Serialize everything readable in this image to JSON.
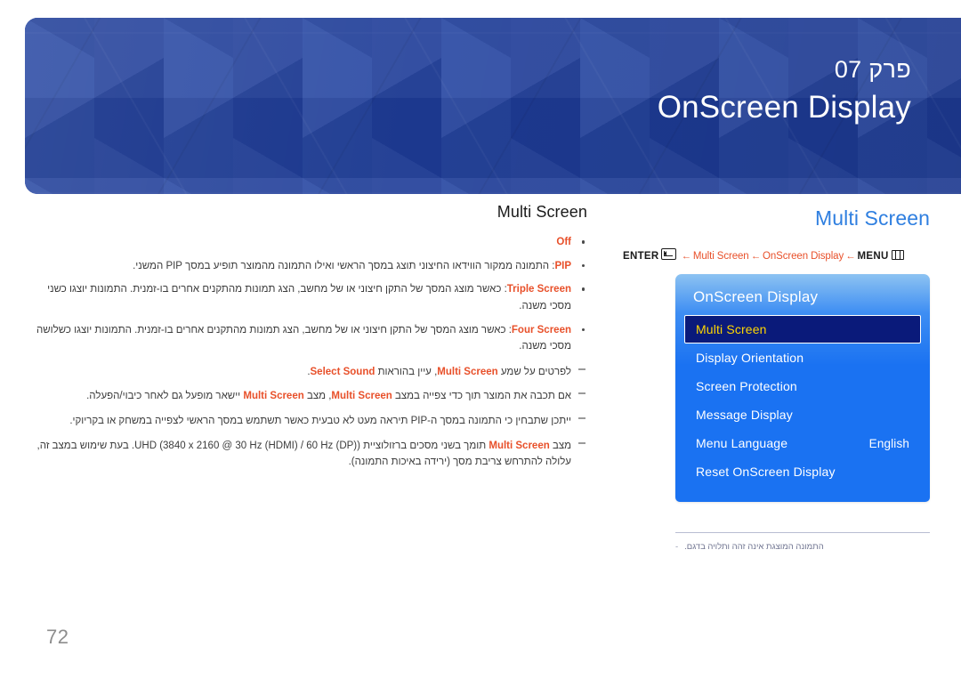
{
  "page": {
    "number": "72",
    "language_dir": "rtl"
  },
  "banner": {
    "chapter_label": "פרק 07",
    "chapter_title": "OnScreen Display",
    "bg_color": "#1f3f9e",
    "text_color": "#ffffff"
  },
  "right_column": {
    "section_title": "Multi Screen",
    "section_title_color": "#2f7fe0",
    "nav_path": {
      "enter_label": "ENTER",
      "enter_icon": "enter-icon",
      "arrow": "←",
      "crumb_1": "Multi Screen",
      "crumb_2": "OnScreen Display",
      "menu_label": "MENU",
      "menu_icon": "menu-icon",
      "crumb_color": "#e8502a"
    },
    "osd_panel": {
      "title": "OnScreen Display",
      "selected_index": 0,
      "selected_bg": "#0a1a7a",
      "selected_text_color": "#ffd700",
      "panel_color": "#1a72f2",
      "items": [
        {
          "label": "Multi Screen",
          "value": ""
        },
        {
          "label": "Display Orientation",
          "value": ""
        },
        {
          "label": "Screen Protection",
          "value": ""
        },
        {
          "label": "Message Display",
          "value": ""
        },
        {
          "label": "Menu Language",
          "value": "English"
        },
        {
          "label": "Reset OnScreen Display",
          "value": ""
        }
      ]
    },
    "footnote": {
      "dash": "-",
      "text": "התמונה המוצגת אינה זהה ותלויה בדגם."
    }
  },
  "left_column": {
    "section_title": "Multi Screen",
    "bullets": [
      {
        "term": "Off",
        "text": ""
      },
      {
        "term": "PIP",
        "text": ": התמונה ממקור הווידאו החיצוני תוצג במסך הראשי ואילו התמונה מהמוצר תופיע במסך PIP המשני."
      },
      {
        "term": "Triple Screen",
        "text": ": כאשר מוצג המסך של התקן חיצוני או של מחשב, הצג תמונות מהתקנים אחרים בו-זמנית. התמונות יוצגו כשני מסכי משנה."
      },
      {
        "term": "Four Screen",
        "text": ": כאשר מוצג המסך של התקן חיצוני או של מחשב, הצג תמונות מהתקנים אחרים בו-זמנית. התמונות יוצגו כשלושה מסכי משנה."
      }
    ],
    "notes": [
      {
        "parts": [
          {
            "type": "text",
            "value": "לפרטים על שמע "
          },
          {
            "type": "kw",
            "value": "Multi Screen"
          },
          {
            "type": "text",
            "value": ", עיין בהוראות "
          },
          {
            "type": "kw",
            "value": "Select Sound"
          },
          {
            "type": "text",
            "value": "."
          }
        ]
      },
      {
        "parts": [
          {
            "type": "text",
            "value": "אם תכבה את המוצר תוך כדי צפייה במצב "
          },
          {
            "type": "kw",
            "value": "Multi Screen"
          },
          {
            "type": "text",
            "value": ", מצב "
          },
          {
            "type": "kw",
            "value": "Multi Screen"
          },
          {
            "type": "text",
            "value": " יישאר מופעל גם לאחר כיבוי/הפעלה."
          }
        ]
      },
      {
        "parts": [
          {
            "type": "text",
            "value": "ייתכן שתבחין כי התמונה במסך ה-PIP תיראה מעט לא טבעית כאשר תשתמש במסך הראשי לצפייה במשחק או בקריוקי."
          }
        ]
      },
      {
        "parts": [
          {
            "type": "text",
            "value": "מצב "
          },
          {
            "type": "kw",
            "value": "Multi Screen"
          },
          {
            "type": "text",
            "value": " תומך בשני מסכים ברזולוציית UHD (3840 x 2160 @ 30 Hz (HDMI) / 60 Hz (DP)). בעת שימוש במצב זה, עלולה להתרחש צריבת מסך (ירידה באיכות התמונה)."
          }
        ]
      }
    ]
  }
}
